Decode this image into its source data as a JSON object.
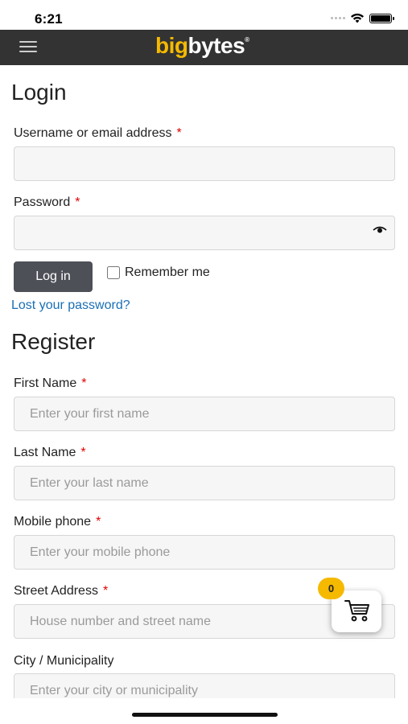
{
  "status_bar": {
    "time": "6:21"
  },
  "header": {
    "logo_part1": "big",
    "logo_part2": "bytes",
    "logo_mark": "®",
    "menu_icon": "hamburger-icon"
  },
  "login": {
    "title": "Login",
    "username_label": "Username or email address",
    "password_label": "Password",
    "required_mark": "*",
    "login_button": "Log in",
    "remember_label": "Remember me",
    "lost_password": "Lost your password?"
  },
  "register": {
    "title": "Register",
    "first_name_label": "First Name",
    "first_name_placeholder": "Enter your first name",
    "last_name_label": "Last Name",
    "last_name_placeholder": "Enter your last name",
    "mobile_label": "Mobile phone",
    "mobile_placeholder": "Enter your mobile phone",
    "street_label": "Street Address",
    "street_placeholder": "House number and street name",
    "city_label": "City / Municipality",
    "city_placeholder": "Enter your city or municipality"
  },
  "cart": {
    "count": "0"
  },
  "colors": {
    "accent": "#f5b900",
    "header_bg": "#333333",
    "link": "#1a6fb5",
    "required": "#e00000"
  }
}
